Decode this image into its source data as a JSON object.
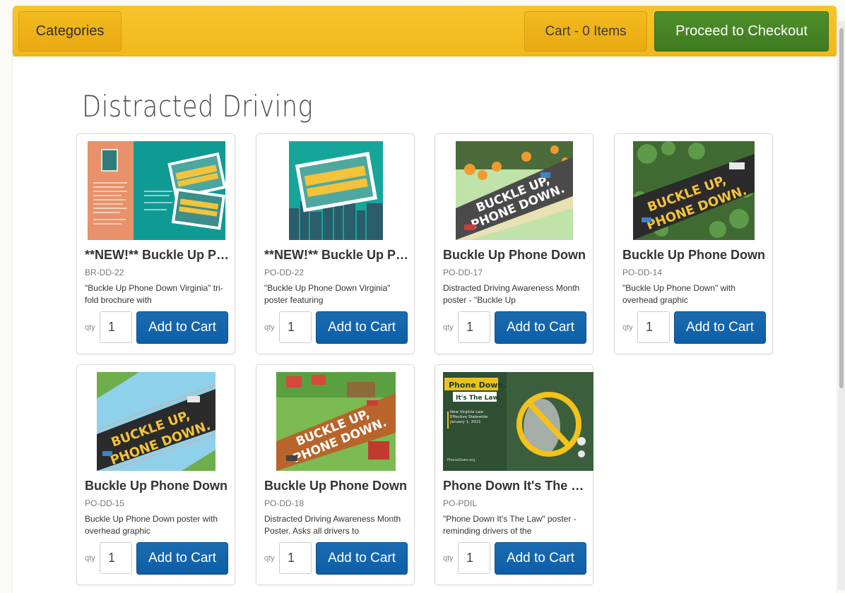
{
  "toolbar": {
    "categories_label": "Categories",
    "cart_label": "Cart - 0 Items",
    "checkout_label": "Proceed to Checkout"
  },
  "page": {
    "title": "Distracted Driving"
  },
  "product_common": {
    "qty_label": "qty",
    "qty_value": "1",
    "add_label": "Add to Cart"
  },
  "products": [
    {
      "name": "**NEW!** Buckle Up Phone Down Virginia",
      "sku": "BR-DD-22",
      "desc": "\"Buckle Up Phone Down Virginia\" tri-fold brochure with"
    },
    {
      "name": "**NEW!** Buckle Up Phone Down Virginia",
      "sku": "PO-DD-22",
      "desc": "\"Buckle Up Phone Down Virginia\" poster featuring"
    },
    {
      "name": "Buckle Up Phone Down",
      "sku": "PO-DD-17",
      "desc": "Distracted Driving Awareness Month poster - \"Buckle Up"
    },
    {
      "name": "Buckle Up Phone Down",
      "sku": "PO-DD-14",
      "desc": "\"Buckle Up Phone Down\" with overhead graphic"
    },
    {
      "name": "Buckle Up Phone Down",
      "sku": "PO-DD-15",
      "desc": "Buckle Up Phone Down poster with overhead graphic"
    },
    {
      "name": "Buckle Up Phone Down",
      "sku": "PO-DD-18",
      "desc": "Distracted Driving Awareness Month Poster. Asks all drivers to"
    },
    {
      "name": "Phone Down It's The Law",
      "sku": "PO-PDIL",
      "desc": "\"Phone Down It's The Law\" poster - reminding drivers of the"
    }
  ],
  "artwork": {
    "buckle_up": "BUCKLE UP,",
    "phone_down": "PHONE DOWN.",
    "pd_head": "Phone Down.",
    "pd_law": "It's The Law.",
    "pd_small": "New Virginia Law Effective Statewide January 1, 2021",
    "pd_url": "PhoneDown.org"
  },
  "colors": {
    "toolbar_yellow": "#f2b81a",
    "checkout_green": "#447f23",
    "add_blue": "#0d5fa7"
  }
}
